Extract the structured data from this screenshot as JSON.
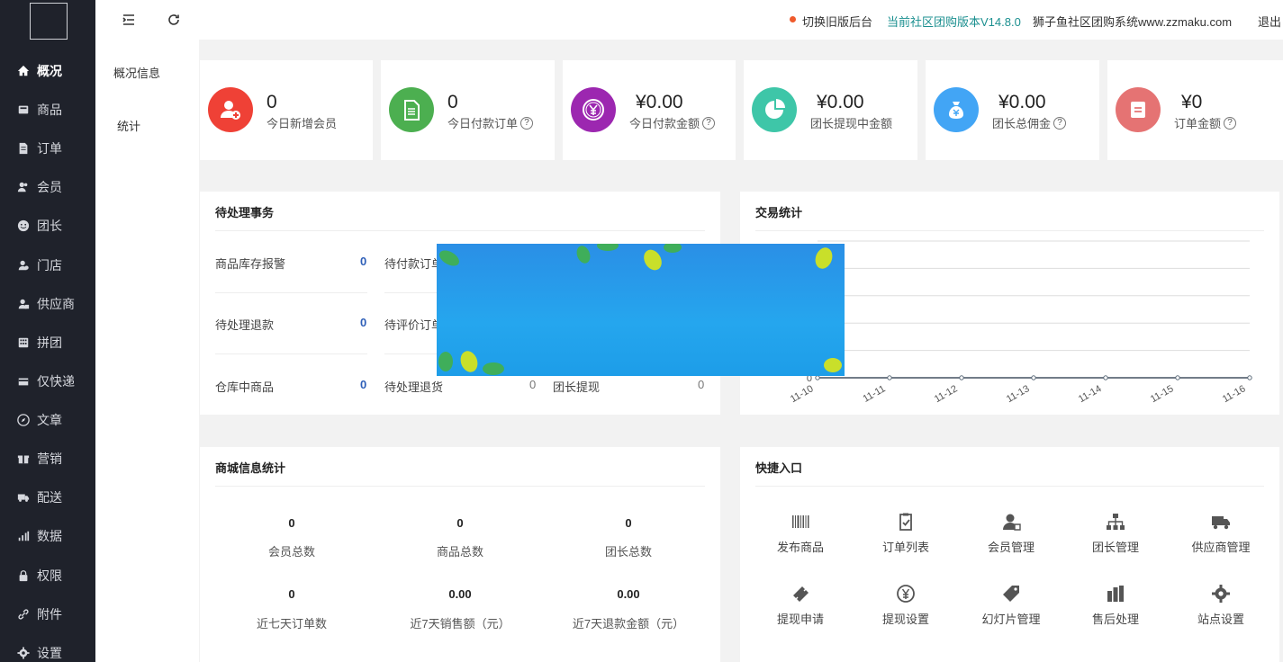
{
  "sidebar": {
    "items": [
      {
        "label": "概况",
        "icon": "home-icon",
        "active": true
      },
      {
        "label": "商品",
        "icon": "goods-icon"
      },
      {
        "label": "订单",
        "icon": "order-icon"
      },
      {
        "label": "会员",
        "icon": "member-icon"
      },
      {
        "label": "团长",
        "icon": "leader-icon"
      },
      {
        "label": "门店",
        "icon": "store-icon"
      },
      {
        "label": "供应商",
        "icon": "supplier-icon"
      },
      {
        "label": "拼团",
        "icon": "group-buy-icon"
      },
      {
        "label": "仅快递",
        "icon": "express-icon"
      },
      {
        "label": "文章",
        "icon": "compass-icon"
      },
      {
        "label": "营销",
        "icon": "gift-icon"
      },
      {
        "label": "配送",
        "icon": "truck-icon"
      },
      {
        "label": "数据",
        "icon": "bar-chart-icon"
      },
      {
        "label": "权限",
        "icon": "lock-icon"
      },
      {
        "label": "附件",
        "icon": "link-icon"
      },
      {
        "label": "设置",
        "icon": "gear-icon"
      }
    ]
  },
  "subnav": {
    "items": [
      {
        "label": "概况信息"
      },
      {
        "label": "统计"
      }
    ]
  },
  "topbar": {
    "switch_label": "切换旧版后台",
    "version_label": "当前社区团购版本V14.8.0",
    "site_label": "狮子鱼社区团购系统www.zzmaku.com",
    "logout_label": "退出",
    "version_color": "#1a8f8f",
    "dot_color": "#ef5a2c"
  },
  "stats": [
    {
      "value": "0",
      "label": "今日新增会员",
      "help": false,
      "color": "#ef4136",
      "icon": "add-user-icon"
    },
    {
      "value": "0",
      "label": "今日付款订单",
      "help": true,
      "color": "#4caf50",
      "icon": "document-icon"
    },
    {
      "value": "¥0.00",
      "label": "今日付款金额",
      "help": true,
      "color": "#9c27b0",
      "icon": "yen-coin-icon"
    },
    {
      "value": "¥0.00",
      "label": "团长提现中金额",
      "help": false,
      "color": "#3ec6a8",
      "icon": "pie-icon"
    },
    {
      "value": "¥0.00",
      "label": "团长总佣金",
      "help": true,
      "color": "#42a5f5",
      "icon": "money-bag-icon"
    },
    {
      "value": "¥0",
      "label": "订单金额",
      "help": true,
      "color": "#e57373",
      "icon": "list-box-icon"
    }
  ],
  "todo": {
    "title": "待处理事务",
    "items": [
      {
        "label": "商品库存报警",
        "value": "0"
      },
      {
        "label": "待付款订单",
        "value": ""
      },
      {
        "label": "待处理退款",
        "value": "0"
      },
      {
        "label": "待评价订单",
        "value": ""
      },
      {
        "label": "仓库中商品",
        "value": "0"
      },
      {
        "label": "待处理退货",
        "value": "0"
      },
      {
        "label": "团长提现",
        "value": "0"
      }
    ]
  },
  "trade": {
    "title": "交易统计"
  },
  "chart_data": {
    "type": "line",
    "title": "交易统计",
    "x": [
      "11-10",
      "11-11",
      "11-12",
      "11-13",
      "11-14",
      "11-15",
      "11-16"
    ],
    "series": [
      {
        "values": [
          0,
          0,
          0,
          0,
          0,
          0,
          0
        ]
      }
    ],
    "grid": true,
    "ylim": [
      0,
      5
    ]
  },
  "shop_stats": {
    "title": "商城信息统计",
    "items": [
      {
        "value": "0",
        "label": "会员总数"
      },
      {
        "value": "0",
        "label": "商品总数"
      },
      {
        "value": "0",
        "label": "团长总数"
      },
      {
        "value": "0",
        "label": "近七天订单数"
      },
      {
        "value": "0.00",
        "label": "近7天销售额（元）"
      },
      {
        "value": "0.00",
        "label": "近7天退款金额（元）"
      }
    ]
  },
  "quick": {
    "title": "快捷入口",
    "items": [
      {
        "label": "发布商品",
        "icon": "barcode-icon"
      },
      {
        "label": "订单列表",
        "icon": "clipboard-check-icon"
      },
      {
        "label": "会员管理",
        "icon": "user-manage-icon"
      },
      {
        "label": "团长管理",
        "icon": "org-chart-icon"
      },
      {
        "label": "供应商管理",
        "icon": "truck-icon"
      },
      {
        "label": "提现申请",
        "icon": "ticket-icon"
      },
      {
        "label": "提现设置",
        "icon": "yen-circle-icon"
      },
      {
        "label": "幻灯片管理",
        "icon": "tag-icon"
      },
      {
        "label": "售后处理",
        "icon": "bars-icon"
      },
      {
        "label": "站点设置",
        "icon": "gear-icon"
      }
    ]
  }
}
